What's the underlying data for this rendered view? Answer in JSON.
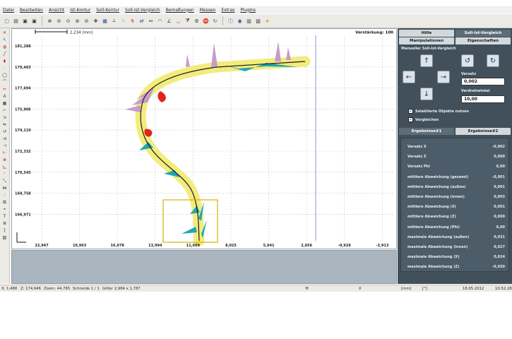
{
  "menu": [
    "Datei",
    "Bearbeiten",
    "Ansicht",
    "Ist-Kontur",
    "Soll-Kontur",
    "Soll-Ist-Vergleich",
    "Bemaßungen",
    "Messen",
    "Extras",
    "PlugIns"
  ],
  "plot": {
    "scale_label": "2,234 [mm]",
    "amplification_label": "Verstärkung: 100",
    "y_ticks": [
      "181,288",
      "179,403",
      "177,694",
      "175,906",
      "174,119",
      "172,332",
      "170,545",
      "168,758",
      "166,971"
    ],
    "x_ticks": [
      "22,947",
      "19,963",
      "16,978",
      "13,994",
      "11,009",
      "8,025",
      "5,041",
      "2,056",
      "-0,928",
      "-3,913"
    ],
    "colors": {
      "grid": "#c9c9c9",
      "tolerance_band": "#f3ec7c",
      "contour": "#1c1c1c",
      "deviation_positive": "#c79bcc",
      "deviation_negative": "#1fa7b5",
      "deviation_alert": "#e0241b",
      "selection_box": "#d4b000",
      "vertical_marker": "#8f93d3"
    }
  },
  "panel": {
    "tabs_top": [
      "Hilfe",
      "Soll-Ist-Vergleich"
    ],
    "tabs_second": [
      "Manipulationen",
      "Eigenschaften"
    ],
    "manual_title": "Manueller Soll-Ist-Vergleich",
    "versatz_label": "Versatz",
    "versatz_value": "0,002",
    "drehwinkel_label": "Verdrehwinkel",
    "drehwinkel_value": "10,00",
    "checkbox_selected": "Selektierte Objekte nutzen",
    "checkbox_compare": "Vergleichen",
    "result_tabs": [
      "Ergebnisse#1",
      "Ergebnisse#2"
    ],
    "results": [
      {
        "label": "Versatz X",
        "value": "-0,002"
      },
      {
        "label": "Versatz Z",
        "value": "0,000"
      },
      {
        "label": "Versatz Phi",
        "value": "0,00"
      },
      {
        "label": "mittlere Abweichung (gesamt)",
        "value": "-0,001"
      },
      {
        "label": "mittlere Abweichung (außen)",
        "value": "0,001"
      },
      {
        "label": "mittlere Abweichung (innen)",
        "value": "0,003"
      },
      {
        "label": "mittlere Abweichung (X)",
        "value": "0,001"
      },
      {
        "label": "mittlere Abweichung (Z)",
        "value": "0,000"
      },
      {
        "label": "mittlere Abweichung (Phi)",
        "value": "0,00"
      },
      {
        "label": "maximale Abweichung (außen)",
        "value": "0,031"
      },
      {
        "label": "maximale Abweichung (innen)",
        "value": "0,027"
      },
      {
        "label": "maximale Abweichung (X)",
        "value": "0,024"
      },
      {
        "label": "maximale Abweichung (Z)",
        "value": "-0,030"
      }
    ]
  },
  "status": {
    "x": "X: 1,488",
    "z": "Z: 174,946",
    "zoom": "Zoom: 44,765",
    "schneide": "Schneide 1 / 1",
    "gitter": "Gitter 2,984 x 1,787",
    "unit": "[mm]",
    "angle_unit": "[°]",
    "date": "18.05.2012",
    "time": "10:52:28"
  }
}
